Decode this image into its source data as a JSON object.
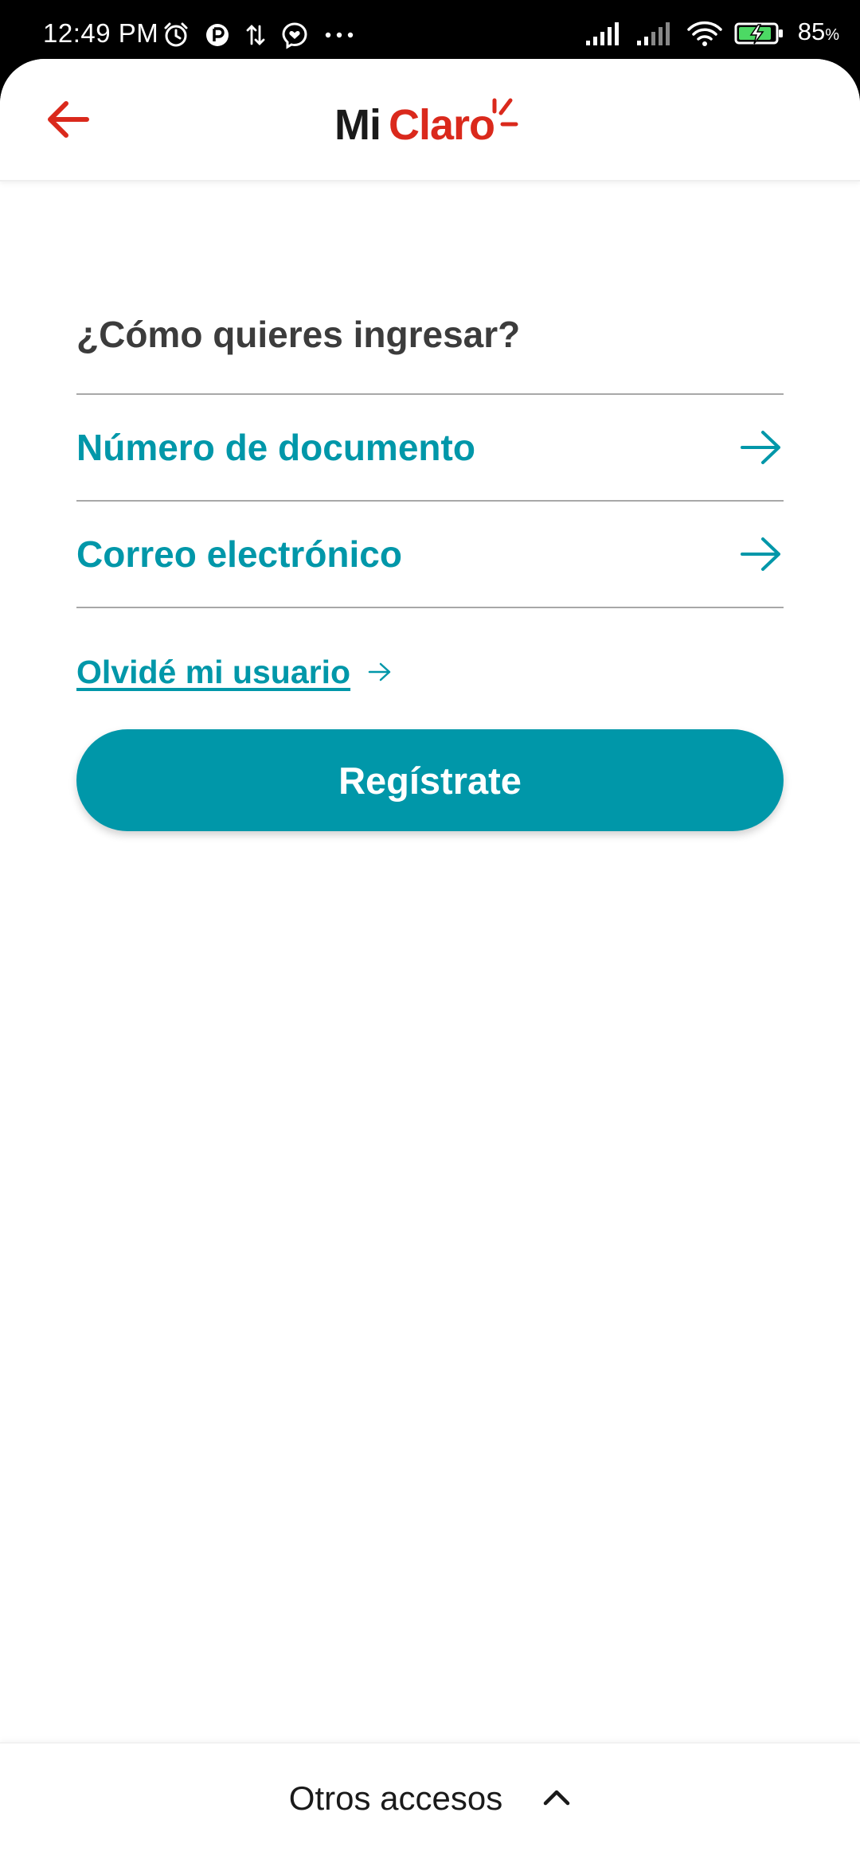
{
  "status_bar": {
    "time": "12:49 PM",
    "battery_percent": "85",
    "battery_unit": "%",
    "icons_left": [
      "alarm-icon",
      "app-notification-icon",
      "data-transfer-icon",
      "messenger-icon",
      "more-dots-icon"
    ],
    "icons_right": [
      "signal-icon",
      "signal-2-icon",
      "wifi-icon",
      "battery-charging-icon"
    ]
  },
  "header": {
    "logo_mi": "Mi",
    "logo_claro": "Claro",
    "back_icon": "arrow-left-icon"
  },
  "main": {
    "title": "¿Cómo quieres ingresar?",
    "options": [
      {
        "label": "Número de documento",
        "icon": "arrow-right-icon"
      },
      {
        "label": "Correo electrónico",
        "icon": "arrow-right-icon"
      }
    ],
    "forgot_link": "Olvidé mi usuario",
    "register_button": "Regístrate"
  },
  "bottom_bar": {
    "label": "Otros accesos",
    "icon": "chevron-up-icon"
  },
  "colors": {
    "brand_red": "#da291c",
    "accent_teal": "#0097a9",
    "title_gray": "#3c3c3c"
  }
}
